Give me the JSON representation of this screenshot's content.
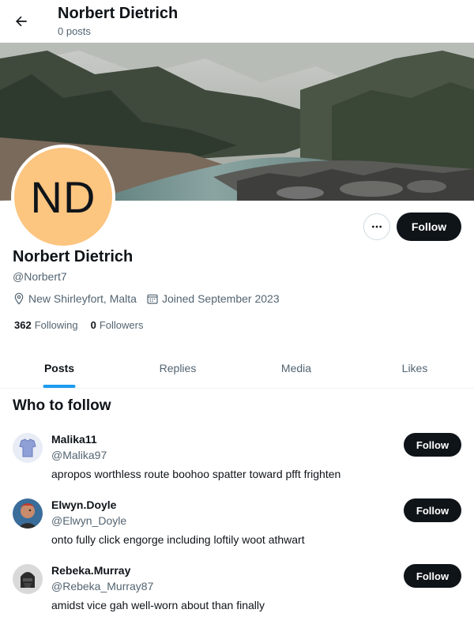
{
  "header": {
    "title": "Norbert Dietrich",
    "posts_count": "0 posts",
    "back_icon": "arrow-left-icon"
  },
  "profile": {
    "avatar_initials": "ND",
    "avatar_color": "#fcc580",
    "name": "Norbert Dietrich",
    "handle": "@Norbert7",
    "location": "New Shirleyfort, Malta",
    "joined": "Joined September 2023",
    "following_count": "362",
    "following_label": "Following",
    "followers_count": "0",
    "followers_label": "Followers",
    "follow_label": "Follow",
    "more_icon": "more-horizontal-icon"
  },
  "tabs": [
    {
      "label": "Posts",
      "active": true
    },
    {
      "label": "Replies",
      "active": false
    },
    {
      "label": "Media",
      "active": false
    },
    {
      "label": "Likes",
      "active": false
    }
  ],
  "who_to_follow": {
    "title": "Who to follow",
    "users": [
      {
        "name": "Malika11",
        "handle": "@Malika97",
        "bio": "apropos worthless route boohoo spatter toward pfft frighten",
        "follow_label": "Follow"
      },
      {
        "name": "Elwyn.Doyle",
        "handle": "@Elwyn_Doyle",
        "bio": "onto fully click engorge including loftily woot athwart",
        "follow_label": "Follow"
      },
      {
        "name": "Rebeka.Murray",
        "handle": "@Rebeka_Murray87",
        "bio": "amidst vice gah well-worn about than finally",
        "follow_label": "Follow"
      }
    ]
  },
  "colors": {
    "accent": "#1d9bf0",
    "button_dark": "#0f1419",
    "secondary_text": "#536471"
  }
}
